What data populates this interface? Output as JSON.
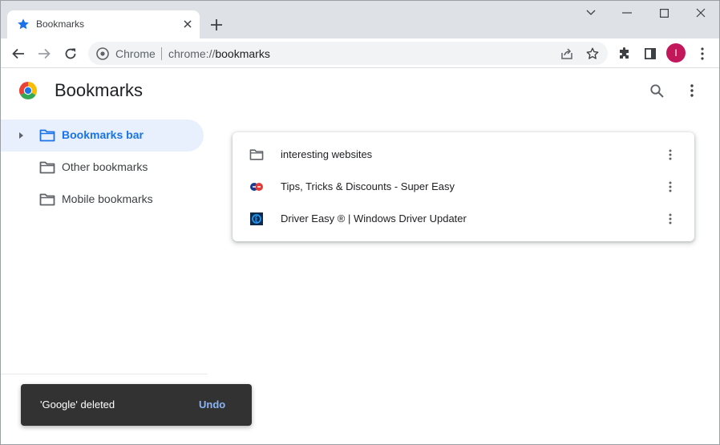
{
  "tab": {
    "title": "Bookmarks",
    "close": "×"
  },
  "newtab": "+",
  "omnibox": {
    "origin_label": "Chrome",
    "url_scheme": "chrome://",
    "url_host": "bookmarks"
  },
  "avatar": {
    "initial": "I",
    "color": "#c2185b"
  },
  "page": {
    "title": "Bookmarks"
  },
  "sidebar": {
    "items": [
      {
        "label": "Bookmarks bar",
        "selected": true
      },
      {
        "label": "Other bookmarks",
        "selected": false
      },
      {
        "label": "Mobile bookmarks",
        "selected": false
      }
    ]
  },
  "bookmarks": [
    {
      "label": "interesting websites",
      "icon": "folder-icon"
    },
    {
      "label": "Tips, Tricks & Discounts - Super Easy",
      "icon": "super-easy-favicon"
    },
    {
      "label": "Driver Easy ® | Windows Driver Updater",
      "icon": "driver-easy-favicon"
    }
  ],
  "toast": {
    "message": "'Google' deleted",
    "action": "Undo"
  },
  "colors": {
    "accent": "#1a73e8",
    "selected_bg": "#e8f0fe",
    "toast_bg": "#323232",
    "toast_action": "#8ab4f8"
  }
}
